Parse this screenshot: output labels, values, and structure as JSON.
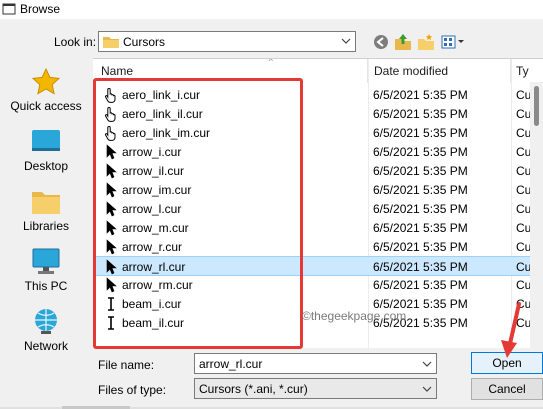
{
  "window": {
    "title": "Browse"
  },
  "look_in": {
    "label": "Look in:",
    "value": "Cursors"
  },
  "toolbar": {
    "icons": [
      "back-icon",
      "up-folder-icon",
      "new-folder-icon",
      "view-menu-icon"
    ]
  },
  "places": [
    {
      "label": "Quick access",
      "icon": "star-icon"
    },
    {
      "label": "Desktop",
      "icon": "desktop-icon"
    },
    {
      "label": "Libraries",
      "icon": "libraries-icon"
    },
    {
      "label": "This PC",
      "icon": "computer-icon"
    },
    {
      "label": "Network",
      "icon": "network-icon"
    }
  ],
  "columns": {
    "name": "Name",
    "date": "Date modified",
    "type": "Ty"
  },
  "files": [
    {
      "name": "aero_link_i.cur",
      "date": "6/5/2021 5:35 PM",
      "type": "Cu",
      "icon": "hand-cursor-icon"
    },
    {
      "name": "aero_link_il.cur",
      "date": "6/5/2021 5:35 PM",
      "type": "Cu",
      "icon": "hand-cursor-icon"
    },
    {
      "name": "aero_link_im.cur",
      "date": "6/5/2021 5:35 PM",
      "type": "Cu",
      "icon": "hand-cursor-icon"
    },
    {
      "name": "arrow_i.cur",
      "date": "6/5/2021 5:35 PM",
      "type": "Cu",
      "icon": "arrow-cursor-icon"
    },
    {
      "name": "arrow_il.cur",
      "date": "6/5/2021 5:35 PM",
      "type": "Cu",
      "icon": "arrow-cursor-icon"
    },
    {
      "name": "arrow_im.cur",
      "date": "6/5/2021 5:35 PM",
      "type": "Cu",
      "icon": "arrow-cursor-icon"
    },
    {
      "name": "arrow_l.cur",
      "date": "6/5/2021 5:35 PM",
      "type": "Cu",
      "icon": "arrow-cursor-icon"
    },
    {
      "name": "arrow_m.cur",
      "date": "6/5/2021 5:35 PM",
      "type": "Cu",
      "icon": "arrow-cursor-icon"
    },
    {
      "name": "arrow_r.cur",
      "date": "6/5/2021 5:35 PM",
      "type": "Cu",
      "icon": "arrow-cursor-icon"
    },
    {
      "name": "arrow_rl.cur",
      "date": "6/5/2021 5:35 PM",
      "type": "Cu",
      "icon": "arrow-cursor-icon",
      "selected": true
    },
    {
      "name": "arrow_rm.cur",
      "date": "6/5/2021 5:35 PM",
      "type": "Cu",
      "icon": "arrow-cursor-icon"
    },
    {
      "name": "beam_i.cur",
      "date": "6/5/2021 5:35 PM",
      "type": "Cu",
      "icon": "ibeam-cursor-icon"
    },
    {
      "name": "beam_il.cur",
      "date": "6/5/2021 5:35 PM",
      "type": "Cu",
      "icon": "ibeam-cursor-icon"
    }
  ],
  "watermark": "©thegeekpage.com",
  "file_name": {
    "label": "File name:",
    "value": "arrow_rl.cur"
  },
  "files_of_type": {
    "label": "Files of type:",
    "value": "Cursors (*.ani, *.cur)"
  },
  "buttons": {
    "open": "Open",
    "cancel": "Cancel"
  },
  "colors": {
    "selection": "#cce8ff",
    "highlight_box": "#e53935",
    "accent": "#0078d7"
  }
}
